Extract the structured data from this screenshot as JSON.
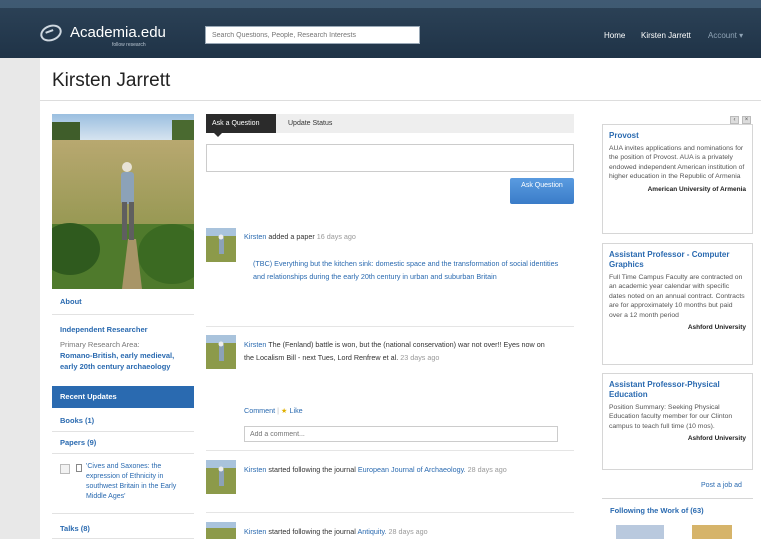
{
  "header": {
    "logo_text": "Academia.edu",
    "logo_tagline": "follow research",
    "search_placeholder": "Search Questions, People, Research Interests",
    "nav": [
      "Home",
      "Kirsten Jarrett",
      "Account ▾"
    ]
  },
  "profile": {
    "name": "Kirsten Jarrett",
    "about_label": "About",
    "position": "Independent Researcher",
    "research_area_label": "Primary Research Area:",
    "research_area": "Romano-British, early medieval, early 20th century archaeology",
    "recent_updates": "Recent Updates",
    "books": "Books (1)",
    "papers": "Papers (9)",
    "paper_item": "'Cives and Saxones: the expression of Ethnicity in southwest Britain in the Early Middle Ages'",
    "talks": "Talks (8)"
  },
  "composer": {
    "tab_ask": "Ask a Question",
    "tab_status": "Update Status",
    "ask_button": "Ask Question"
  },
  "feed": [
    {
      "who": "Kirsten",
      "action": " added a paper ",
      "ago": "16 days ago",
      "paper": "(TBC) Everything but the kitchen sink: domestic space and the transformation of social identities and relationships during the early 20th century in urban and suburban Britain"
    },
    {
      "who": "Kirsten",
      "text": " The (Fenland) battle is won, but the (national conservation) war not over!! Eyes now on the Localism Bill - next Tues, Lord Renfrew et al. ",
      "ago": "23 days ago",
      "comment": "Comment",
      "like": "Like",
      "comment_placeholder": "Add a comment..."
    },
    {
      "who": "Kirsten",
      "action": " started following the journal ",
      "target": "European Journal of Archaeology.",
      "ago": "28 days ago"
    },
    {
      "who": "Kirsten",
      "action": " started following the journal ",
      "target": "Antiquity.",
      "ago": "28 days ago"
    }
  ],
  "ads": [
    {
      "title": "Provost",
      "body": "AUA invites applications and nominations for the position of Provost. AUA is a privately endowed independent American institution of higher education in the Republic of Armenia",
      "org": "American University of Armenia"
    },
    {
      "title": "Assistant Professor - Computer Graphics",
      "body": "Full Time Campus Faculty are contracted on an academic year calendar with specific dates noted on an annual contract. Contracts are for approximately 10 months but paid over a 12 month period",
      "org": "Ashford University"
    },
    {
      "title": "Assistant Professor-Physical Education",
      "body": "Position Summary: Seeking Physical Education faculty member for our Clinton campus to teach full time (10 mos).",
      "org": "Ashford University"
    }
  ],
  "post_job": "Post a job ad",
  "following_label": "Following the Work of (63)",
  "colors": {
    "accent": "#2a6ab0",
    "header": "#243a4f"
  }
}
